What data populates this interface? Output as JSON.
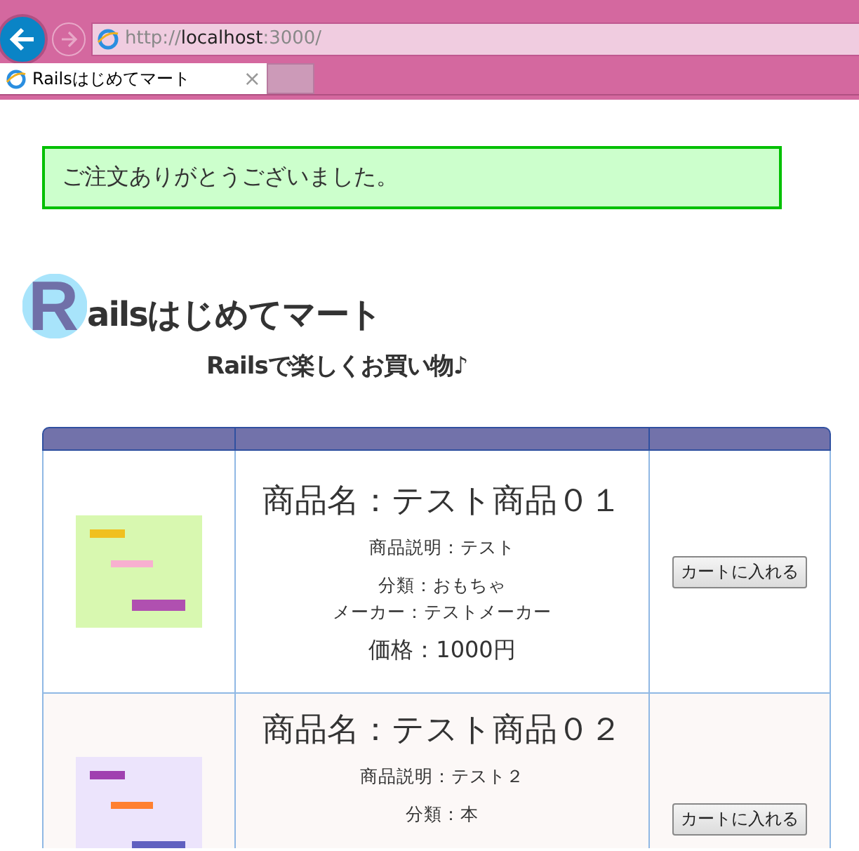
{
  "browser": {
    "url_prefix": "http://",
    "url_host": "localhost",
    "url_suffix": ":3000/",
    "tabs": [
      {
        "title": "Railsはじめてマート",
        "close": "×",
        "selected": true
      }
    ]
  },
  "notice": "ご注文ありがとうございました。",
  "logo": {
    "initial": "R",
    "title": "ailsはじめてマート",
    "tagline": "Railsで楽しくお買い物♪"
  },
  "products": [
    {
      "name": "商品名：テスト商品０１",
      "description": "商品説明：テスト",
      "category": "分類：おもちゃ",
      "maker": "メーカー：テストメーカー",
      "price": "価格：1000円",
      "button": "カートに入れる"
    },
    {
      "name": "商品名：テスト商品０２",
      "description": "商品説明：テスト２",
      "category": "分類：本",
      "button": "カートに入れる"
    }
  ]
}
